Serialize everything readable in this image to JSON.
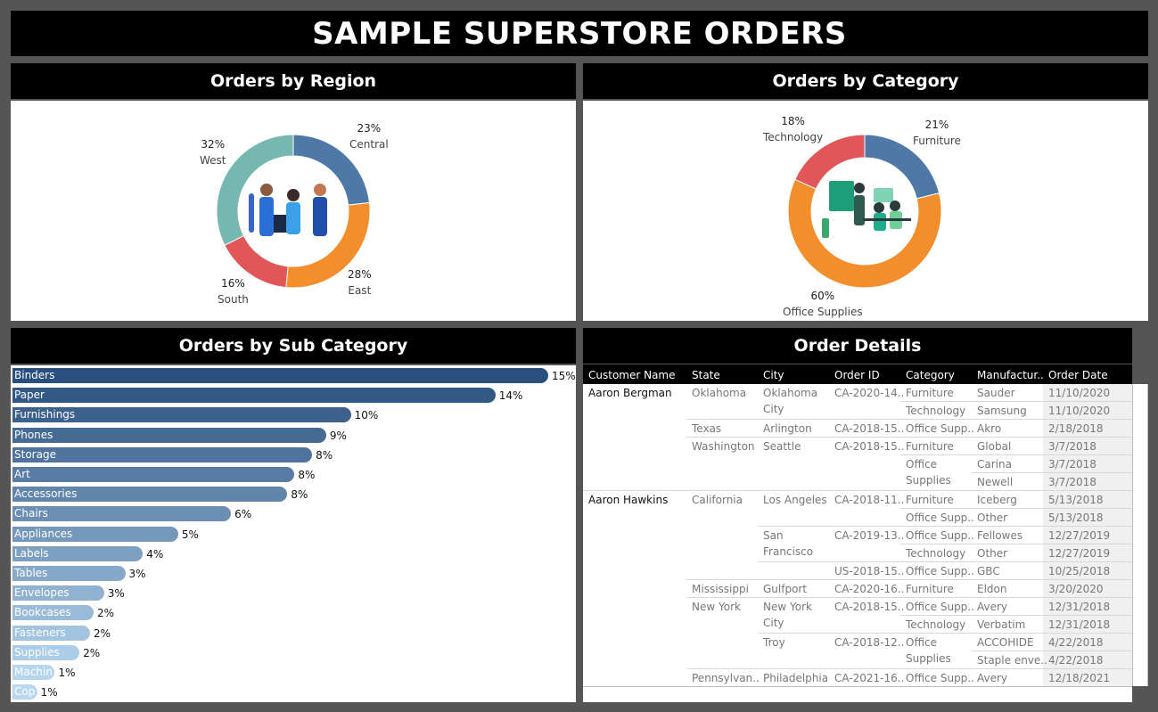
{
  "title": "SAMPLE SUPERSTORE ORDERS",
  "region": {
    "header": "Orders by Region",
    "chart_data": {
      "type": "pie",
      "categories": [
        "Central",
        "East",
        "South",
        "West"
      ],
      "values": [
        23,
        28,
        16,
        32
      ],
      "labels": [
        "23%",
        "28%",
        "16%",
        "32%"
      ],
      "colors": [
        "#4e79a7",
        "#f28e2b",
        "#e15759",
        "#76b7b2"
      ]
    }
  },
  "category": {
    "header": "Orders by Category",
    "chart_data": {
      "type": "pie",
      "categories": [
        "Furniture",
        "Office Supplies",
        "Technology"
      ],
      "values": [
        21,
        60,
        18
      ],
      "labels": [
        "21%",
        "60%",
        "18%"
      ],
      "colors": [
        "#4e79a7",
        "#f28e2b",
        "#e15759"
      ]
    }
  },
  "subcategory": {
    "header": "Orders by Sub Category",
    "chart_data": {
      "type": "bar",
      "orientation": "horizontal",
      "categories": [
        "Binders",
        "Paper",
        "Furnishings",
        "Phones",
        "Storage",
        "Art",
        "Accessories",
        "Chairs",
        "Appliances",
        "Labels",
        "Tables",
        "Envelopes",
        "Bookcases",
        "Fasteners",
        "Supplies",
        "Machines",
        "Copiers"
      ],
      "values": [
        15.2,
        13.7,
        9.6,
        8.9,
        8.5,
        8.0,
        7.8,
        6.2,
        4.7,
        3.7,
        3.2,
        2.6,
        2.3,
        2.2,
        1.9,
        1.2,
        0.7
      ],
      "labels": [
        "15%",
        "14%",
        "10%",
        "9%",
        "8%",
        "8%",
        "8%",
        "6%",
        "5%",
        "4%",
        "3%",
        "3%",
        "2%",
        "2%",
        "2%",
        "1%",
        "1%"
      ]
    }
  },
  "orders": {
    "header": "Order Details",
    "columns": [
      "Customer Name",
      "State",
      "City",
      "Order ID",
      "Category",
      "Manufactur..",
      "Order Date"
    ],
    "rows": [
      {
        "customer": "Aaron Bergman",
        "state": "Oklahoma",
        "city": "Oklahoma City",
        "id": "CA-2020-14..",
        "category": "Furniture",
        "mfr": "Sauder",
        "date": "11/10/2020"
      },
      {
        "customer": "",
        "state": "",
        "city": "",
        "id": "",
        "category": "Technology",
        "mfr": "Samsung",
        "date": "11/10/2020"
      },
      {
        "customer": "",
        "state": "Texas",
        "city": "Arlington",
        "id": "CA-2018-15..",
        "category": "Office Supp..",
        "mfr": "Akro",
        "date": "2/18/2018"
      },
      {
        "customer": "",
        "state": "Washington",
        "city": "Seattle",
        "id": "CA-2018-15..",
        "category": "Furniture",
        "mfr": "Global",
        "date": "3/7/2018"
      },
      {
        "customer": "",
        "state": "",
        "city": "",
        "id": "",
        "category": "Office Supplies",
        "mfr": "Carina",
        "date": "3/7/2018"
      },
      {
        "customer": "",
        "state": "",
        "city": "",
        "id": "",
        "category": "",
        "mfr": "Newell",
        "date": "3/7/2018"
      },
      {
        "customer": "Aaron Hawkins",
        "state": "California",
        "city": "Los Angeles",
        "id": "CA-2018-11..",
        "category": "Furniture",
        "mfr": "Iceberg",
        "date": "5/13/2018"
      },
      {
        "customer": "",
        "state": "",
        "city": "",
        "id": "",
        "category": "Office Supp..",
        "mfr": "Other",
        "date": "5/13/2018"
      },
      {
        "customer": "",
        "state": "",
        "city": "San Francisco",
        "id": "CA-2019-13..",
        "category": "Office Supp..",
        "mfr": "Fellowes",
        "date": "12/27/2019"
      },
      {
        "customer": "",
        "state": "",
        "city": "",
        "id": "",
        "category": "Technology",
        "mfr": "Other",
        "date": "12/27/2019"
      },
      {
        "customer": "",
        "state": "",
        "city": "",
        "id": "US-2018-15..",
        "category": "Office Supp..",
        "mfr": "GBC",
        "date": "10/25/2018"
      },
      {
        "customer": "",
        "state": "Mississippi",
        "city": "Gulfport",
        "id": "CA-2020-16..",
        "category": "Furniture",
        "mfr": "Eldon",
        "date": "3/20/2020"
      },
      {
        "customer": "",
        "state": "New York",
        "city": "New York City",
        "id": "CA-2018-15..",
        "category": "Office Supp..",
        "mfr": "Avery",
        "date": "12/31/2018"
      },
      {
        "customer": "",
        "state": "",
        "city": "",
        "id": "",
        "category": "Technology",
        "mfr": "Verbatim",
        "date": "12/31/2018"
      },
      {
        "customer": "",
        "state": "",
        "city": "Troy",
        "id": "CA-2018-12..",
        "category": "Office Supplies",
        "mfr": "ACCOHIDE",
        "date": "4/22/2018"
      },
      {
        "customer": "",
        "state": "",
        "city": "",
        "id": "",
        "category": "",
        "mfr": "Staple enve..",
        "date": "4/22/2018"
      },
      {
        "customer": "",
        "state": "Pennsylvan..",
        "city": "Philadelphia",
        "id": "CA-2021-16..",
        "category": "Office Supp..",
        "mfr": "Avery",
        "date": "12/18/2021"
      }
    ]
  }
}
